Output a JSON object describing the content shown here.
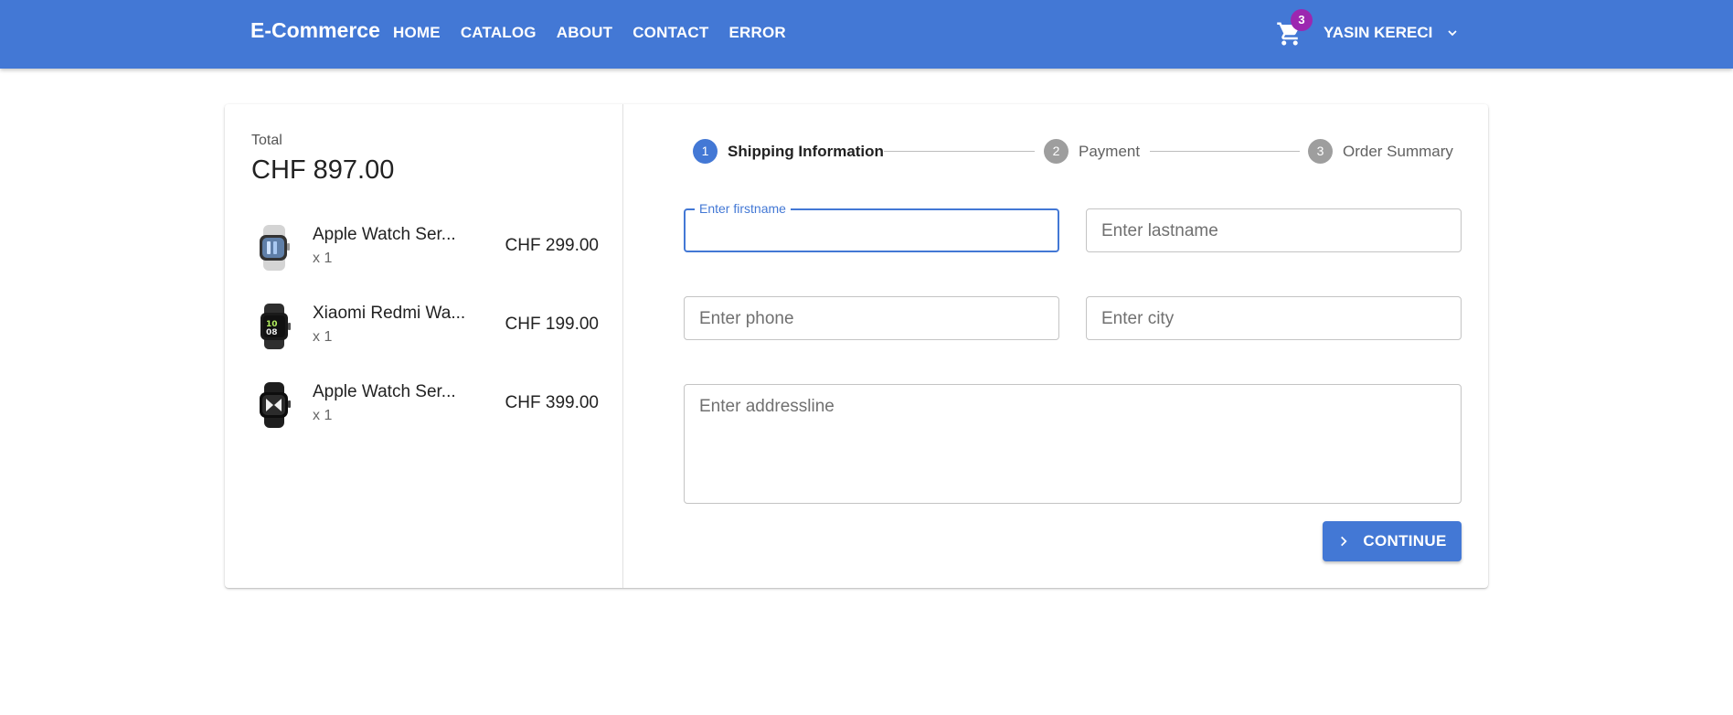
{
  "header": {
    "brand": "E-Commerce",
    "nav": [
      "HOME",
      "CATALOG",
      "ABOUT",
      "CONTACT",
      "ERROR"
    ],
    "cart_count": "3",
    "user_name": "YASIN KERECI",
    "bar_color": "#4378d5"
  },
  "summary": {
    "total_label": "Total",
    "total_value": "CHF 897.00",
    "items": [
      {
        "name": "Apple Watch Ser...",
        "qty": "x 1",
        "price": "CHF 299.00",
        "icon": "watch-silver"
      },
      {
        "name": "Xiaomi Redmi Wa...",
        "qty": "x 1",
        "price": "CHF 199.00",
        "icon": "watch-black"
      },
      {
        "name": "Apple Watch Ser...",
        "qty": "x 1",
        "price": "CHF 399.00",
        "icon": "watch-black-white"
      }
    ]
  },
  "stepper": {
    "steps": [
      {
        "num": "1",
        "label": "Shipping Information",
        "active": true
      },
      {
        "num": "2",
        "label": "Payment",
        "active": false
      },
      {
        "num": "3",
        "label": "Order Summary",
        "active": false
      }
    ],
    "active_color": "#4378d5",
    "inactive_color": "#9e9e9e"
  },
  "form": {
    "firstname_label": "Enter firstname",
    "firstname_value": "",
    "lastname_placeholder": "Enter lastname",
    "phone_placeholder": "Enter phone",
    "city_placeholder": "Enter city",
    "address_placeholder": "Enter addressline",
    "continue_label": "CONTINUE"
  }
}
